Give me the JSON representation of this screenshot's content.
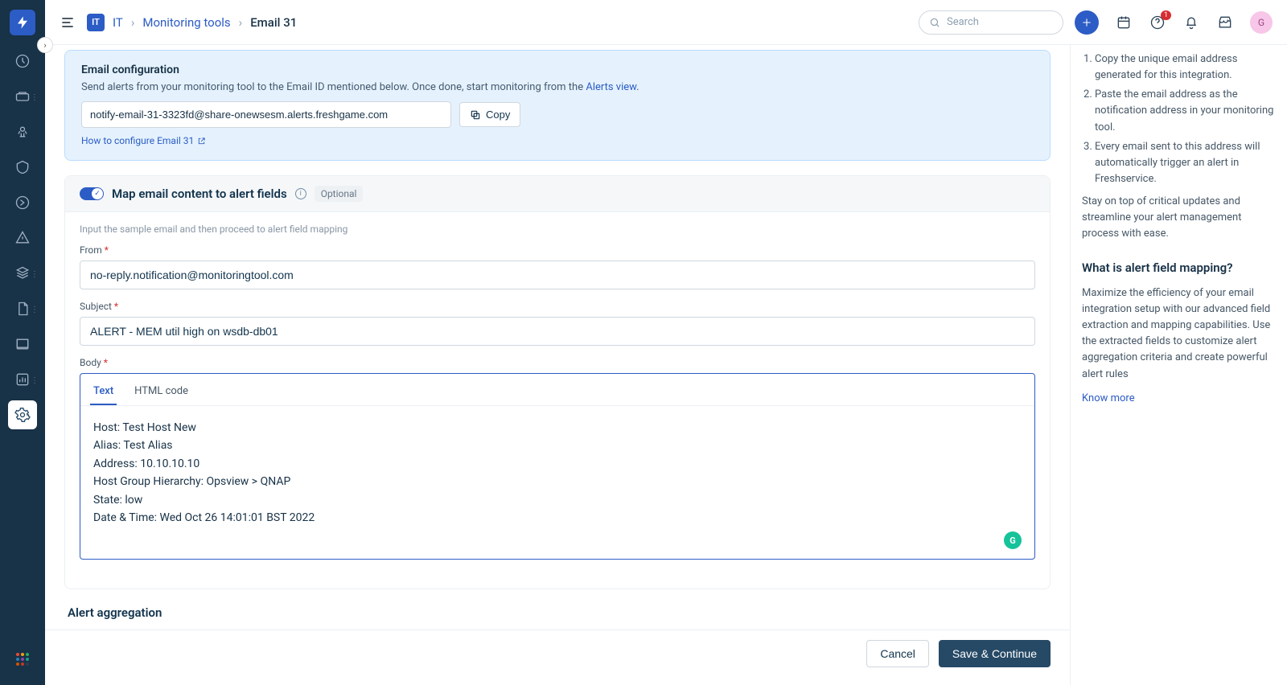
{
  "header": {
    "workspace_badge": "IT",
    "breadcrumb": {
      "root": "IT",
      "level1": "Monitoring tools",
      "current": "Email 31"
    },
    "search_placeholder": "Search",
    "notification_count": "1",
    "avatar_initial": "G"
  },
  "email_config": {
    "title": "Email configuration",
    "description_prefix": "Send alerts from your monitoring tool to the Email ID mentioned below. Once done, start monitoring from the ",
    "alerts_link": "Alerts view",
    "description_suffix": ".",
    "email_value": "notify-email-31-3323fd@share-onewsesm.alerts.freshgame.com",
    "copy_label": "Copy",
    "configure_link": "How to configure Email 31"
  },
  "mapping": {
    "title": "Map email content to alert fields",
    "optional_label": "Optional",
    "hint": "Input the sample email and then proceed to alert field mapping",
    "from_label": "From",
    "from_value": "no-reply.notification@monitoringtool.com",
    "subject_label": "Subject",
    "subject_value": "ALERT - MEM util high on wsdb-db01",
    "body_label": "Body",
    "tabs": {
      "text": "Text",
      "html": "HTML code"
    },
    "body_text": "Host: Test Host New\nAlias: Test Alias\nAddress: 10.10.10.10\nHost Group Hierarchy: Opsview > QNAP\nState: low\nDate & Time: Wed Oct 26 14:01:01 BST 2022"
  },
  "aggregation_title": "Alert aggregation",
  "right_panel": {
    "steps": [
      "Copy the unique email address generated for this integration.",
      "Paste the email address as the notification address in your monitoring tool.",
      "Every email sent to this address will automatically trigger an alert in Freshservice."
    ],
    "stay_text": "Stay on top of critical updates and streamline your alert management process with ease.",
    "mapping_title": "What is alert field mapping?",
    "mapping_text": "Maximize the efficiency of your email integration setup with our advanced field extraction and mapping capabilities. Use the extracted fields to customize alert aggregation criteria and create powerful alert rules",
    "know_more": "Know more"
  },
  "footer": {
    "cancel": "Cancel",
    "save": "Save & Continue"
  }
}
